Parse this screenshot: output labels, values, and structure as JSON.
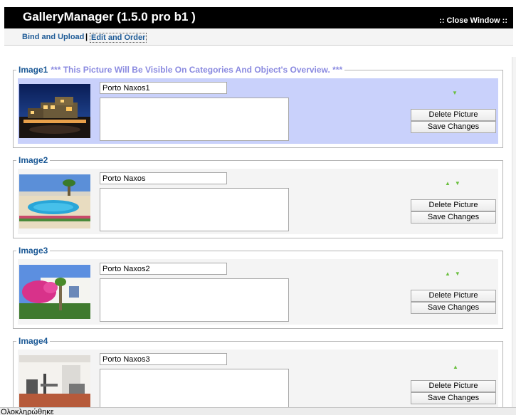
{
  "window": {
    "title": "GalleryManager (1.5.0 pro b1 )",
    "close_label": ":: Close Window ::"
  },
  "nav": {
    "bind_upload": "Bind and Upload",
    "separator": "|",
    "edit_order": "Edit and Order"
  },
  "images": [
    {
      "legend": "Image1",
      "note": "*** This Picture Will Be Visible On Categories And Object's Overview. ***",
      "name": "Porto Naxos1",
      "description": "",
      "delete_label": "Delete Picture",
      "save_label": "Save Changes",
      "arrows": "down",
      "highlight": true
    },
    {
      "legend": "Image2",
      "name": "Porto Naxos",
      "description": "",
      "delete_label": "Delete Picture",
      "save_label": "Save Changes",
      "arrows": "up-down"
    },
    {
      "legend": "Image3",
      "name": "Porto Naxos2",
      "description": "",
      "delete_label": "Delete Picture",
      "save_label": "Save Changes",
      "arrows": "up-down"
    },
    {
      "legend": "Image4",
      "name": "Porto Naxos3",
      "description": "",
      "delete_label": "Delete Picture",
      "save_label": "Save Changes",
      "arrows": "up"
    }
  ],
  "status": {
    "text": "Ολοκληρώθηκε"
  },
  "colors": {
    "title_bar": "#000000",
    "link": "#1d5a96",
    "note": "#8a8ae0",
    "highlight_row": "#c9d1fb",
    "arrow": "#6abf3e"
  }
}
